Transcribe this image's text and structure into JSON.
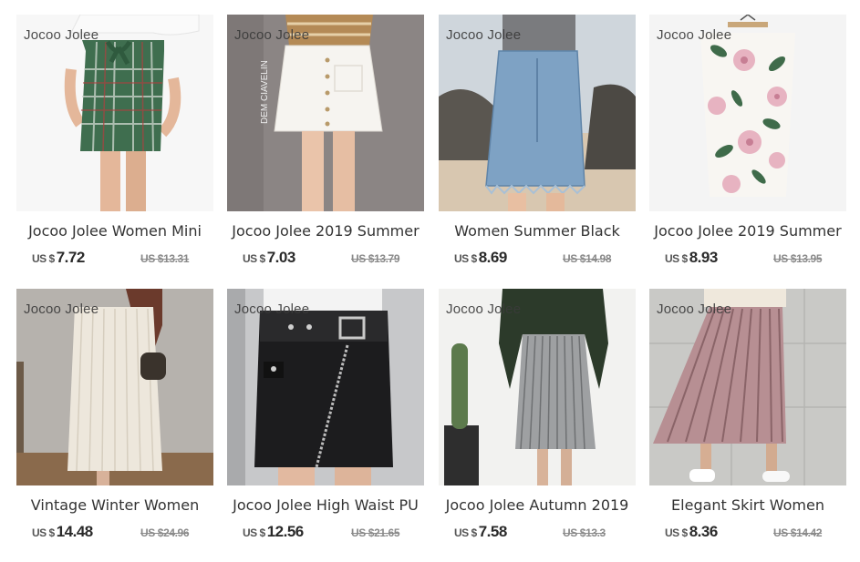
{
  "products": [
    {
      "brand": "Jocoo Jolee",
      "title": "Jocoo Jolee Women Mini",
      "currency": "US $",
      "price": "7.72",
      "old_price": "US $13.31",
      "image": "green-plaid-mini-skirt"
    },
    {
      "brand": "Jocoo Jolee",
      "title": "Jocoo Jolee 2019 Summer",
      "currency": "US $",
      "price": "7.03",
      "old_price": "US $13.79",
      "image": "white-button-a-line-skirt",
      "image_text": "DEM CIAVELIN"
    },
    {
      "brand": "Jocoo Jolee",
      "title": "Women Summer Black",
      "currency": "US $",
      "price": "8.69",
      "old_price": "US $14.98",
      "image": "denim-mini-skirt"
    },
    {
      "brand": "Jocoo Jolee",
      "title": "Jocoo Jolee 2019 Summer",
      "currency": "US $",
      "price": "8.93",
      "old_price": "US $13.95",
      "image": "floral-pencil-skirt"
    },
    {
      "brand": "Jocoo Jolee",
      "title": "Vintage Winter Women",
      "currency": "US $",
      "price": "14.48",
      "old_price": "US $24.96",
      "image": "cream-pleated-midi-skirt"
    },
    {
      "brand": "Jocoo Jolee",
      "title": "Jocoo Jolee High Waist PU",
      "currency": "US $",
      "price": "12.56",
      "old_price": "US $21.65",
      "image": "black-leather-zip-skirt"
    },
    {
      "brand": "Jocoo Jolee",
      "title": "Jocoo Jolee Autumn 2019",
      "currency": "US $",
      "price": "7.58",
      "old_price": "US $13.3",
      "image": "silver-pleated-skirt"
    },
    {
      "brand": "Jocoo Jolee",
      "title": "Elegant Skirt Women",
      "currency": "US $",
      "price": "8.36",
      "old_price": "US $14.42",
      "image": "pink-velvet-pleated-skirt"
    }
  ]
}
